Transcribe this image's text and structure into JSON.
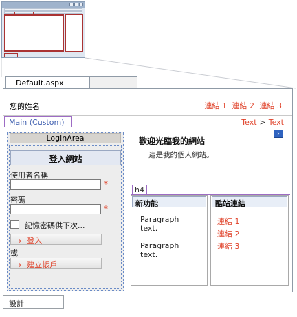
{
  "tabs": {
    "active_label": "Default.aspx"
  },
  "header": {
    "site_name": "您的姓名",
    "links": [
      "連結 1",
      "連結 2",
      "連結 3"
    ]
  },
  "main": {
    "region_label": "Main (Custom)",
    "breadcrumb": {
      "first": "Text",
      "separator": ">",
      "second": "Text"
    }
  },
  "login": {
    "area_title": "LoginArea",
    "heading": "登入網站",
    "username_label": "使用者名稱",
    "password_label": "密碼",
    "required_marker": "*",
    "remember_label": "記憶密碼供下次...",
    "login_button": "登入",
    "or_text": "或",
    "register_button": "建立帳戶",
    "arrow_glyph": "→"
  },
  "content": {
    "welcome": "歡迎光臨我的網站",
    "subtitle": "這是我的個人網站。",
    "nav_glyph": "›",
    "h4_tag": "h4"
  },
  "features": {
    "title": "新功能",
    "paragraphs": [
      "Paragraph text.",
      "Paragraph text."
    ]
  },
  "cool_links": {
    "title": "酷站連結",
    "items": [
      "連結 1",
      "連結 2",
      "連結 3"
    ]
  },
  "bottom": {
    "design_tab": "設計"
  },
  "colors": {
    "link": "#e0432b",
    "region_border": "#9d6cc4",
    "dotted_border": "#6a8bc7"
  }
}
